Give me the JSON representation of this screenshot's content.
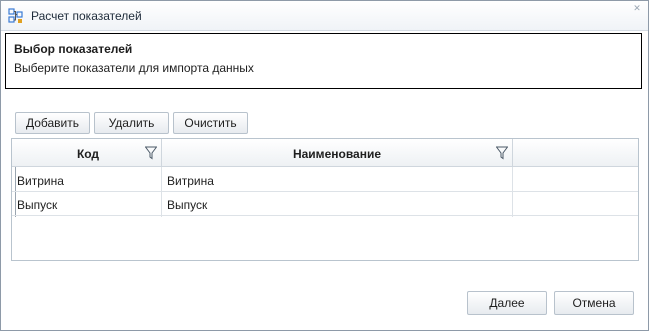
{
  "window": {
    "title": "Расчет показателей",
    "icon": "calculation-grid-icon",
    "close_glyph": "✕"
  },
  "header": {
    "title": "Выбор показателей",
    "subtitle": "Выберите показатели для импорта данных"
  },
  "toolbar": {
    "add_label": "Добавить",
    "delete_label": "Удалить",
    "clear_label": "Очистить"
  },
  "table": {
    "columns": [
      {
        "label": "Код",
        "filter_icon": "filter-icon"
      },
      {
        "label": "Наименование",
        "filter_icon": "filter-icon"
      },
      {
        "label": ""
      }
    ],
    "rows": [
      {
        "code": "Витрина",
        "name": "Витрина"
      },
      {
        "code": "Выпуск",
        "name": "Выпуск"
      }
    ]
  },
  "footer": {
    "next_label": "Далее",
    "cancel_label": "Отмена"
  },
  "colors": {
    "border": "#b9c4ce",
    "header_border": "#000000",
    "title_text": "#1e2b3a",
    "icon_blue": "#3a7bd5"
  }
}
